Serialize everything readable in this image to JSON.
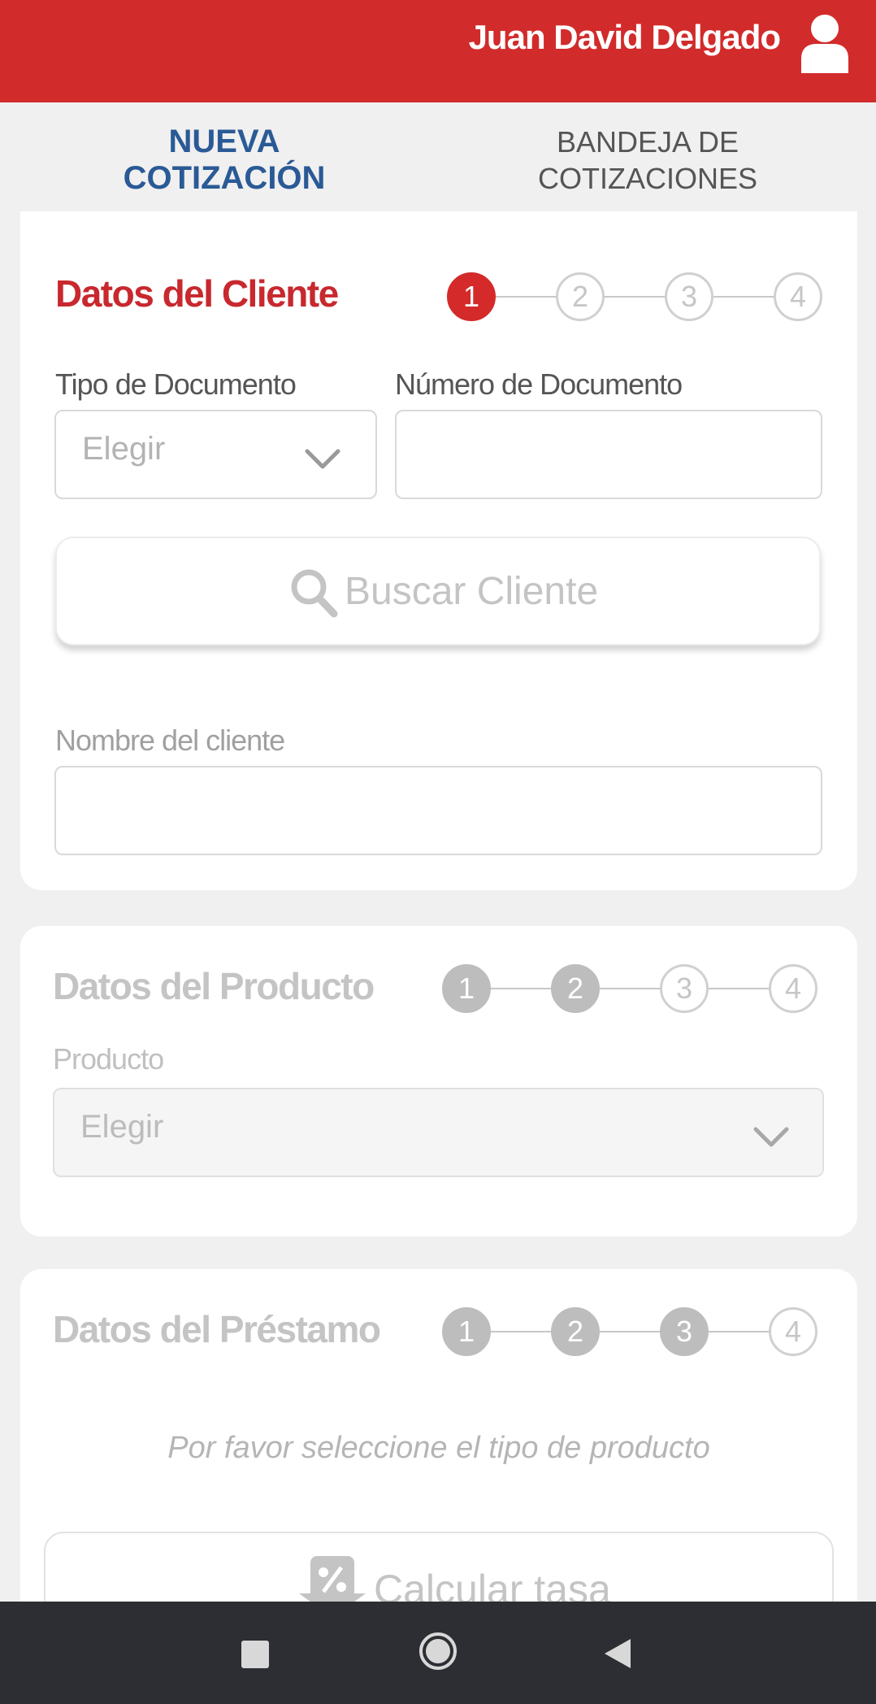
{
  "header": {
    "user_name": "Juan David Delgado",
    "user_icon": "user-icon"
  },
  "tabs": [
    {
      "label": "NUEVA COTIZACIÓN",
      "active": true
    },
    {
      "label": "BANDEJA DE COTIZACIONES",
      "active": false
    }
  ],
  "client_section": {
    "title": "Datos del Cliente",
    "steps": [
      "1",
      "2",
      "3",
      "4"
    ],
    "current_step": 1,
    "doc_type_label": "Tipo de Documento",
    "doc_type_value": "Elegir",
    "doc_number_label": "Número de Documento",
    "doc_number_value": "",
    "search_button": "Buscar Cliente",
    "client_name_label": "Nombre del cliente",
    "client_name_value": ""
  },
  "product_section": {
    "title": "Datos del Producto",
    "steps": [
      "1",
      "2",
      "3",
      "4"
    ],
    "product_label": "Producto",
    "product_value": "Elegir"
  },
  "loan_section": {
    "title": "Datos del Préstamo",
    "steps": [
      "1",
      "2",
      "3",
      "4"
    ],
    "hint": "Por favor seleccione el tipo de producto",
    "calculate_button": "Calcular tasa"
  },
  "colors": {
    "brand_red": "#d22b2b",
    "active_tab_blue": "#2a5a96",
    "nav_bar": "#2d2e33"
  },
  "nav_icons": [
    "recent-apps-icon",
    "home-icon",
    "back-icon"
  ]
}
